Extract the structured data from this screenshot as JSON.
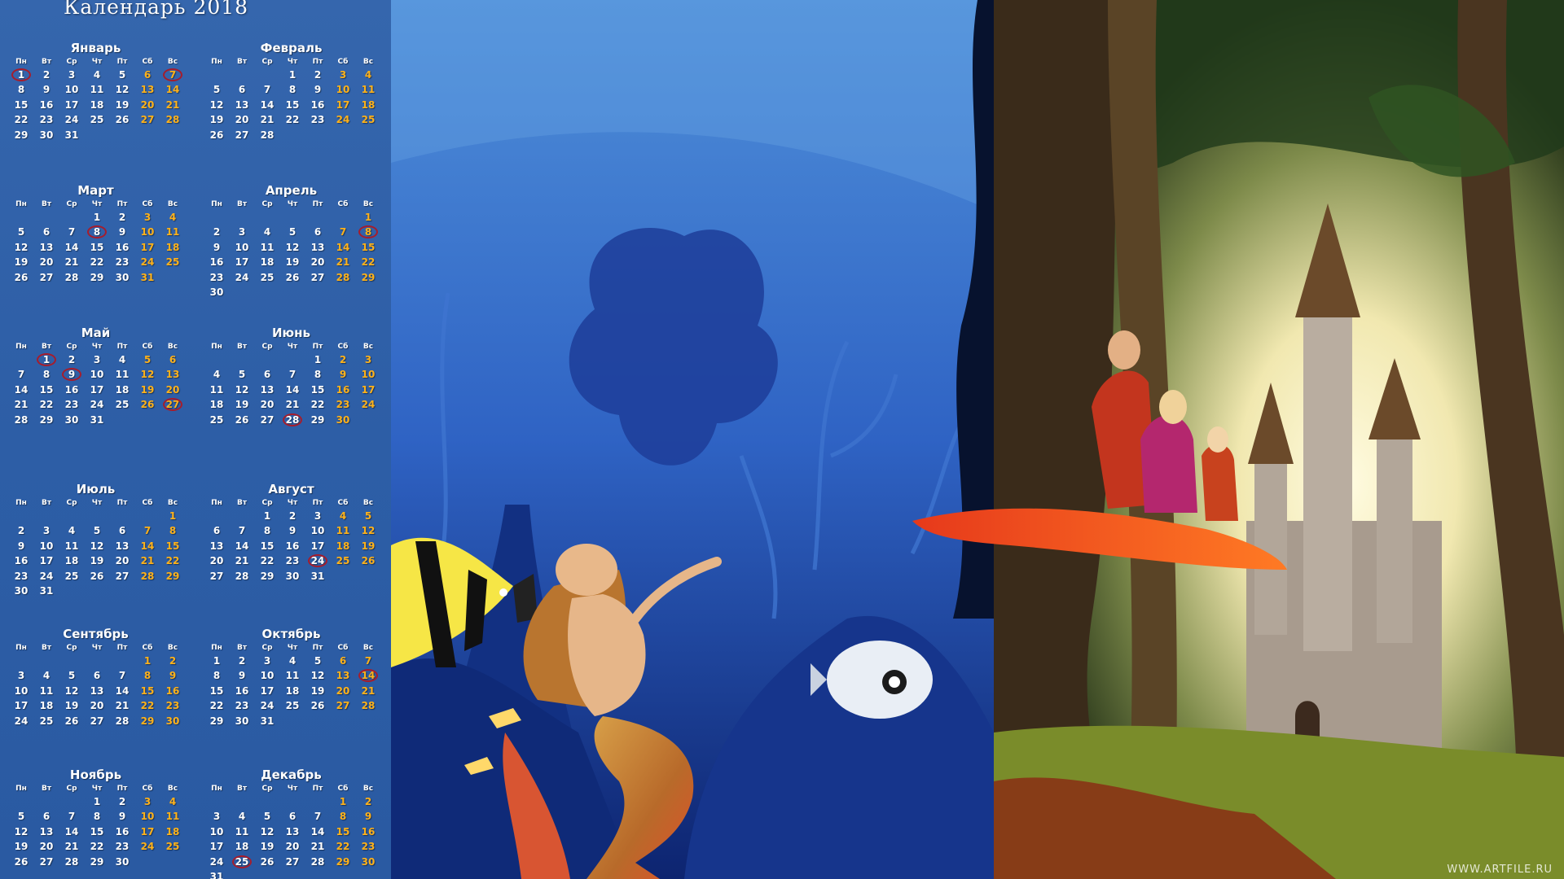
{
  "title": "Календарь 2018",
  "weekdays": [
    "Пн",
    "Вт",
    "Ср",
    "Чт",
    "Пт",
    "Сб",
    "Вс"
  ],
  "months": [
    {
      "name": "Январь",
      "offset": 0,
      "days": 31,
      "highlight": [
        1,
        7
      ]
    },
    {
      "name": "Февраль",
      "offset": 3,
      "days": 28,
      "highlight": []
    },
    {
      "name": "Март",
      "offset": 3,
      "days": 31,
      "highlight": [
        8
      ]
    },
    {
      "name": "Апрель",
      "offset": 6,
      "days": 30,
      "highlight": [
        8
      ]
    },
    {
      "name": "Май",
      "offset": 1,
      "days": 31,
      "highlight": [
        1,
        9,
        27
      ]
    },
    {
      "name": "Июнь",
      "offset": 4,
      "days": 30,
      "highlight": [
        28
      ]
    },
    {
      "name": "Июль",
      "offset": 6,
      "days": 31,
      "highlight": []
    },
    {
      "name": "Август",
      "offset": 2,
      "days": 31,
      "highlight": [
        24
      ]
    },
    {
      "name": "Сентябрь",
      "offset": 5,
      "days": 30,
      "highlight": []
    },
    {
      "name": "Октябрь",
      "offset": 0,
      "days": 31,
      "highlight": [
        14
      ]
    },
    {
      "name": "Ноябрь",
      "offset": 3,
      "days": 30,
      "highlight": []
    },
    {
      "name": "Декабрь",
      "offset": 5,
      "days": 31,
      "highlight": [
        25
      ]
    }
  ],
  "colors": {
    "panel": "#2f5fa6",
    "weekend": "#ffb21a",
    "highlight": "#a51d2d"
  },
  "watermark": "WWW.ARTFILE.RU"
}
